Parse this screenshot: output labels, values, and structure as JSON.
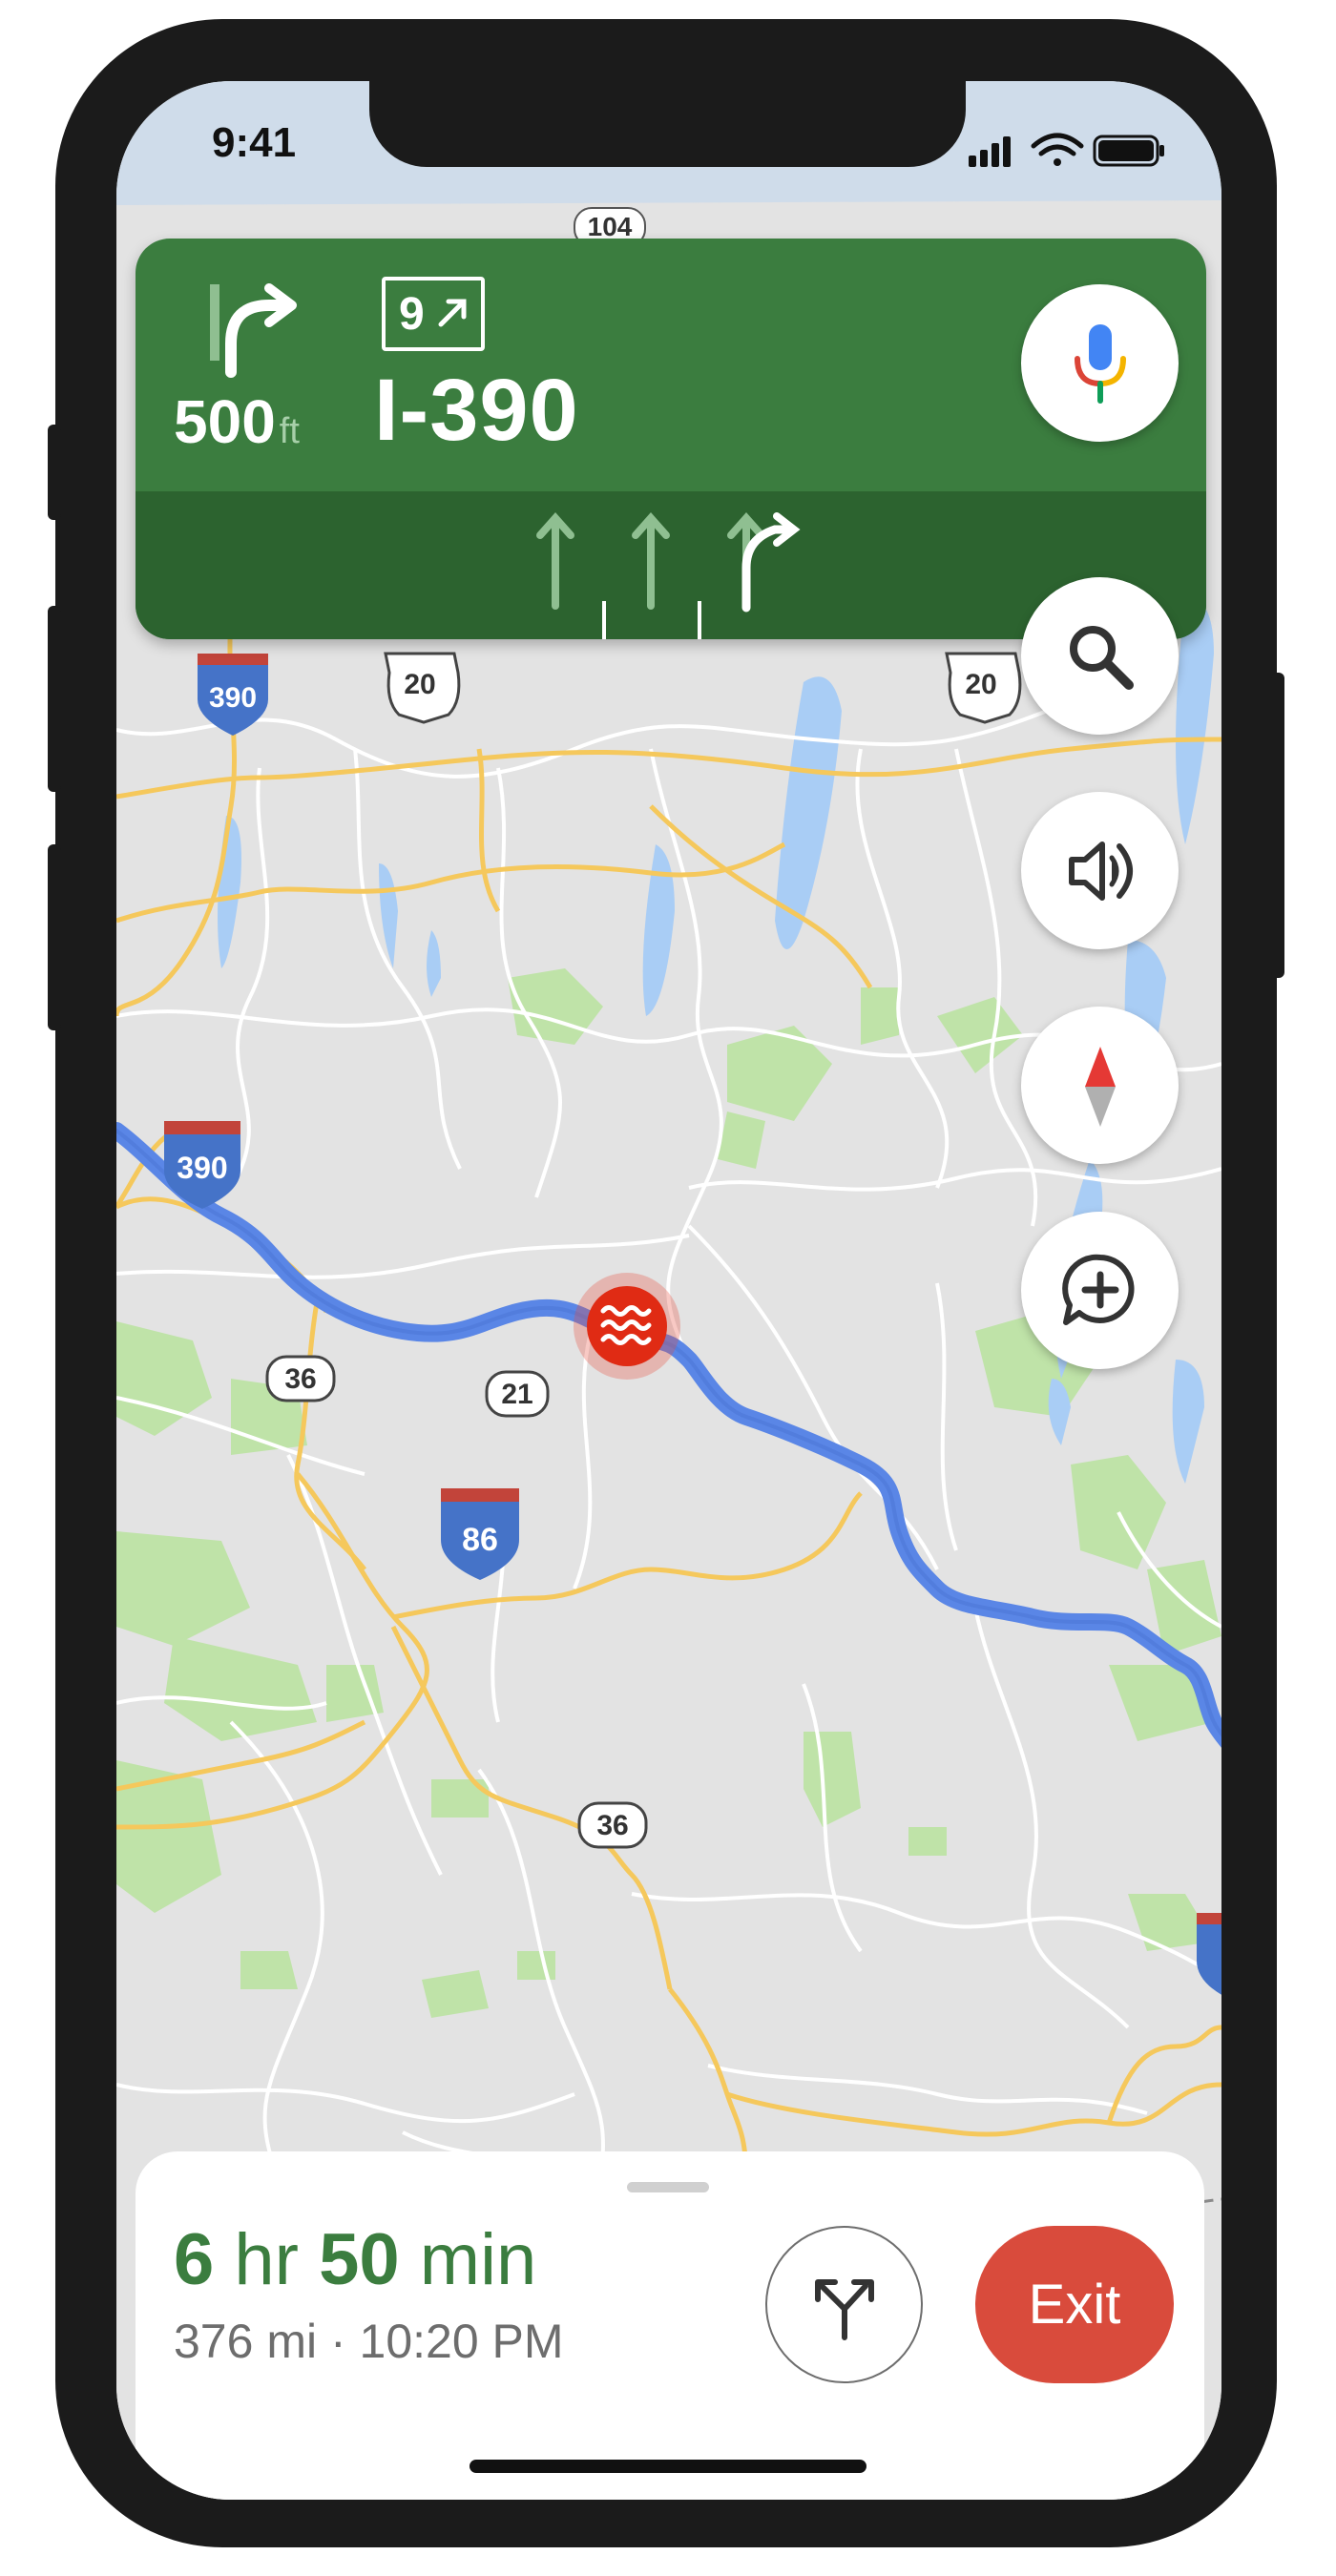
{
  "status_bar": {
    "time": "9:41"
  },
  "navigation": {
    "distance_value": "500",
    "distance_unit": "ft",
    "exit_number": "9",
    "road_name": "I-390",
    "lane_count": 3
  },
  "map": {
    "shields": {
      "top_route": "104",
      "i390_north": "390",
      "us20_west": "20",
      "us20_east": "20",
      "i390_south": "390",
      "route36_north": "36",
      "route21": "21",
      "i86": "86",
      "route36_south": "36"
    },
    "incident": "flood-icon"
  },
  "controls": {
    "voice": "microphone-icon",
    "search": "search-icon",
    "sound": "speaker-icon",
    "compass": "compass-icon",
    "report": "add-report-icon"
  },
  "trip": {
    "hours_value": "6",
    "hours_unit": "hr",
    "minutes_value": "50",
    "minutes_unit": "min",
    "details": "376 mi · 10:20 PM",
    "exit_label": "Exit"
  },
  "colors": {
    "nav_green": "#3b7d3f",
    "lane_green": "#2c632f",
    "route_blue": "#5a86e6",
    "exit_red": "#d94b3c"
  }
}
